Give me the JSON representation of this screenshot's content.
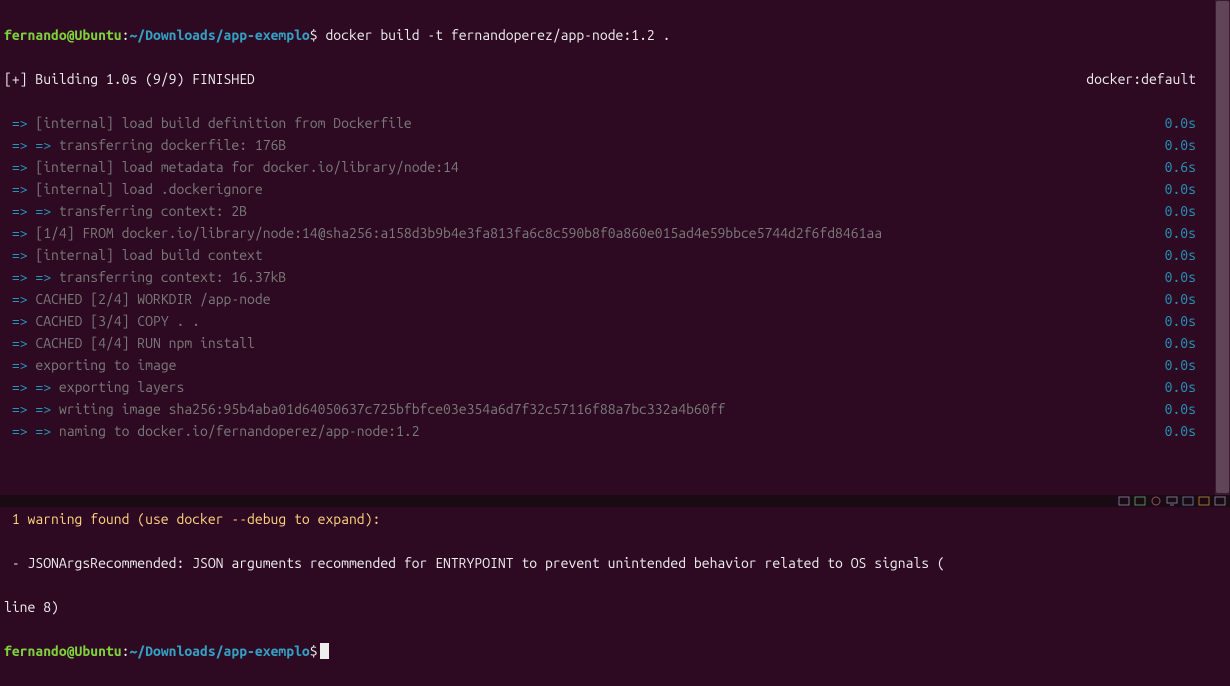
{
  "prompt1": {
    "user": "fernando@Ubuntu",
    "sep": ":",
    "path": "~/Downloads/app-exemplo",
    "dollar": "$",
    "command": " docker build -t fernandoperez/app-node:1.2 ."
  },
  "buildHeader": {
    "left": "[+] Building 1.0s (9/9) FINISHED",
    "right": "docker:default"
  },
  "steps": [
    {
      "arrow": " => ",
      "text": "[internal] load build definition from Dockerfile",
      "time": "0.0s"
    },
    {
      "arrow": " => => ",
      "text": "transferring dockerfile: 176B",
      "time": "0.0s"
    },
    {
      "arrow": " => ",
      "text": "[internal] load metadata for docker.io/library/node:14",
      "time": "0.6s"
    },
    {
      "arrow": " => ",
      "text": "[internal] load .dockerignore",
      "time": "0.0s"
    },
    {
      "arrow": " => => ",
      "text": "transferring context: 2B",
      "time": "0.0s"
    },
    {
      "arrow": " => ",
      "text": "[1/4] FROM docker.io/library/node:14@sha256:a158d3b9b4e3fa813fa6c8c590b8f0a860e015ad4e59bbce5744d2f6fd8461aa",
      "time": "0.0s"
    },
    {
      "arrow": " => ",
      "text": "[internal] load build context",
      "time": "0.0s"
    },
    {
      "arrow": " => => ",
      "text": "transferring context: 16.37kB",
      "time": "0.0s"
    },
    {
      "arrow": " => ",
      "text": "CACHED [2/4] WORKDIR /app-node",
      "time": "0.0s"
    },
    {
      "arrow": " => ",
      "text": "CACHED [3/4] COPY . .",
      "time": "0.0s"
    },
    {
      "arrow": " => ",
      "text": "CACHED [4/4] RUN npm install",
      "time": "0.0s"
    },
    {
      "arrow": " => ",
      "text": "exporting to image",
      "time": "0.0s"
    },
    {
      "arrow": " => => ",
      "text": "exporting layers",
      "time": "0.0s"
    },
    {
      "arrow": " => => ",
      "text": "writing image sha256:95b4aba01d64050637c725bfbfce03e354a6d7f32c57116f88a7bc332a4b60ff",
      "time": "0.0s"
    },
    {
      "arrow": " => => ",
      "text": "naming to docker.io/fernandoperez/app-node:1.2",
      "time": "0.0s"
    }
  ],
  "warning": {
    "header": " 1 warning found (use docker --debug to expand):",
    "line1": " - JSONArgsRecommended: JSON arguments recommended for ENTRYPOINT to prevent unintended behavior related to OS signals (",
    "line2": "line 8)"
  },
  "prompt2": {
    "user": "fernando@Ubuntu",
    "sep": ":",
    "path": "~/Downloads/app-exemplo",
    "dollar": "$"
  }
}
